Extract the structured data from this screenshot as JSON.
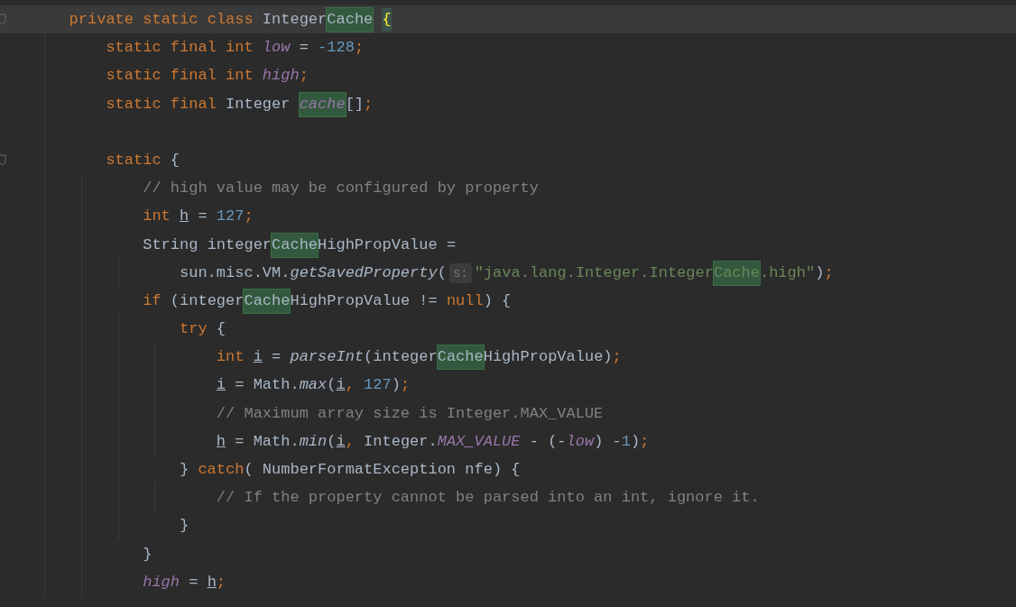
{
  "editor": {
    "lines": [
      {
        "current": true,
        "fold": true,
        "tokens": [
          {
            "kind": "keyword",
            "text": "private static class "
          },
          {
            "kind": "plain",
            "text": "Integer"
          },
          {
            "kind": "match",
            "text": "Cache"
          },
          {
            "kind": "brace",
            "text": "{"
          }
        ],
        "children": [
          {
            "current": false,
            "fold": false,
            "tokens": [
              {
                "kind": "keyword",
                "text": "static final int "
              },
              {
                "kind": "field",
                "text": "low"
              },
              {
                "kind": "plain",
                "text": " = "
              },
              {
                "kind": "number",
                "text": "-128"
              },
              {
                "kind": "punct",
                "text": ";"
              }
            ]
          },
          {
            "current": false,
            "fold": false,
            "tokens": [
              {
                "kind": "keyword",
                "text": "static final int "
              },
              {
                "kind": "field",
                "text": "high"
              },
              {
                "kind": "punct",
                "text": ";"
              }
            ]
          },
          {
            "current": false,
            "fold": false,
            "tokens": [
              {
                "kind": "keyword",
                "text": "static final "
              },
              {
                "kind": "plain",
                "text": "Integer "
              },
              {
                "kind": "field-match",
                "text": "cache"
              },
              {
                "kind": "plain",
                "text": "[]"
              },
              {
                "kind": "punct",
                "text": ";"
              }
            ]
          },
          {
            "current": false,
            "fold": false
          },
          {
            "current": false,
            "fold": true,
            "tokens": [
              {
                "kind": "keyword",
                "text": "static "
              },
              {
                "kind": "plain",
                "text": "{"
              }
            ],
            "children": [
              {
                "current": false,
                "fold": false,
                "tokens": [
                  {
                    "kind": "comment",
                    "text": "// high value may be configured by property"
                  }
                ]
              },
              {
                "current": false,
                "fold": false,
                "tokens": [
                  {
                    "kind": "keyword",
                    "text": "int "
                  },
                  {
                    "kind": "var",
                    "text": "h"
                  },
                  {
                    "kind": "plain",
                    "text": " = "
                  },
                  {
                    "kind": "number",
                    "text": "127"
                  },
                  {
                    "kind": "punct",
                    "text": ";"
                  }
                ]
              },
              {
                "current": false,
                "fold": false,
                "tokens": [
                  {
                    "kind": "plain",
                    "text": "String integer"
                  },
                  {
                    "kind": "match",
                    "text": "Cache"
                  },
                  {
                    "kind": "plain",
                    "text": "HighPropValue ="
                  }
                ],
                "children": [
                  {
                    "current": false,
                    "fold": false,
                    "tokens": [
                      {
                        "kind": "plain",
                        "text": "sun.misc.VM."
                      },
                      {
                        "kind": "call",
                        "text": "getSavedProperty"
                      },
                      {
                        "kind": "plain",
                        "text": "("
                      },
                      {
                        "kind": "hint",
                        "text": "s:"
                      },
                      {
                        "kind": "string",
                        "text": "\"java.lang.Integer.Integer"
                      },
                      {
                        "kind": "string-match",
                        "text": "Cache"
                      },
                      {
                        "kind": "string",
                        "text": ".high\""
                      },
                      {
                        "kind": "plain",
                        "text": ")"
                      },
                      {
                        "kind": "punct",
                        "text": ";"
                      }
                    ]
                  }
                ]
              },
              {
                "current": false,
                "fold": false,
                "tokens": [
                  {
                    "kind": "keyword",
                    "text": "if "
                  },
                  {
                    "kind": "plain",
                    "text": "(integer"
                  },
                  {
                    "kind": "match",
                    "text": "Cache"
                  },
                  {
                    "kind": "plain",
                    "text": "HighPropValue != "
                  },
                  {
                    "kind": "keyword",
                    "text": "null"
                  },
                  {
                    "kind": "plain",
                    "text": ") {"
                  }
                ],
                "children": [
                  {
                    "current": false,
                    "fold": false,
                    "tokens": [
                      {
                        "kind": "keyword",
                        "text": "try "
                      },
                      {
                        "kind": "plain",
                        "text": "{"
                      }
                    ],
                    "children": [
                      {
                        "current": false,
                        "fold": false,
                        "tokens": [
                          {
                            "kind": "keyword",
                            "text": "int "
                          },
                          {
                            "kind": "var",
                            "text": "i"
                          },
                          {
                            "kind": "plain",
                            "text": " = "
                          },
                          {
                            "kind": "call",
                            "text": "parseInt"
                          },
                          {
                            "kind": "plain",
                            "text": "(integer"
                          },
                          {
                            "kind": "match",
                            "text": "Cache"
                          },
                          {
                            "kind": "plain",
                            "text": "HighPropValue)"
                          },
                          {
                            "kind": "punct",
                            "text": ";"
                          }
                        ]
                      },
                      {
                        "current": false,
                        "fold": false,
                        "tokens": [
                          {
                            "kind": "var",
                            "text": "i"
                          },
                          {
                            "kind": "plain",
                            "text": " = Math."
                          },
                          {
                            "kind": "call",
                            "text": "max"
                          },
                          {
                            "kind": "plain",
                            "text": "("
                          },
                          {
                            "kind": "var",
                            "text": "i"
                          },
                          {
                            "kind": "punct",
                            "text": ", "
                          },
                          {
                            "kind": "number",
                            "text": "127"
                          },
                          {
                            "kind": "plain",
                            "text": ")"
                          },
                          {
                            "kind": "punct",
                            "text": ";"
                          }
                        ]
                      },
                      {
                        "current": false,
                        "fold": false,
                        "tokens": [
                          {
                            "kind": "comment",
                            "text": "// Maximum array size is Integer.MAX_VALUE"
                          }
                        ]
                      },
                      {
                        "current": false,
                        "fold": false,
                        "tokens": [
                          {
                            "kind": "var",
                            "text": "h"
                          },
                          {
                            "kind": "plain",
                            "text": " = Math."
                          },
                          {
                            "kind": "call",
                            "text": "min"
                          },
                          {
                            "kind": "plain",
                            "text": "("
                          },
                          {
                            "kind": "var",
                            "text": "i"
                          },
                          {
                            "kind": "punct",
                            "text": ", "
                          },
                          {
                            "kind": "plain",
                            "text": "Integer."
                          },
                          {
                            "kind": "field",
                            "text": "MAX_VALUE"
                          },
                          {
                            "kind": "plain",
                            "text": " - (-"
                          },
                          {
                            "kind": "field",
                            "text": "low"
                          },
                          {
                            "kind": "plain",
                            "text": ") -"
                          },
                          {
                            "kind": "number",
                            "text": "1"
                          },
                          {
                            "kind": "plain",
                            "text": ")"
                          },
                          {
                            "kind": "punct",
                            "text": ";"
                          }
                        ]
                      }
                    ]
                  },
                  {
                    "current": false,
                    "fold": false,
                    "tokens": [
                      {
                        "kind": "plain",
                        "text": "} "
                      },
                      {
                        "kind": "keyword",
                        "text": "catch"
                      },
                      {
                        "kind": "plain",
                        "text": "( NumberFormatException nfe) {"
                      }
                    ],
                    "children": [
                      {
                        "current": false,
                        "fold": false,
                        "tokens": [
                          {
                            "kind": "comment",
                            "text": "// If the property cannot be parsed into an int, ignore it."
                          }
                        ]
                      }
                    ]
                  },
                  {
                    "current": false,
                    "fold": false,
                    "tokens": [
                      {
                        "kind": "plain",
                        "text": "}"
                      }
                    ]
                  }
                ]
              },
              {
                "current": false,
                "fold": false,
                "tokens": [
                  {
                    "kind": "plain",
                    "text": "}"
                  }
                ]
              },
              {
                "current": false,
                "fold": false,
                "tokens": [
                  {
                    "kind": "field",
                    "text": "high"
                  },
                  {
                    "kind": "plain",
                    "text": " = "
                  },
                  {
                    "kind": "var",
                    "text": "h"
                  },
                  {
                    "kind": "punct",
                    "text": ";"
                  }
                ]
              }
            ]
          }
        ]
      }
    ]
  }
}
